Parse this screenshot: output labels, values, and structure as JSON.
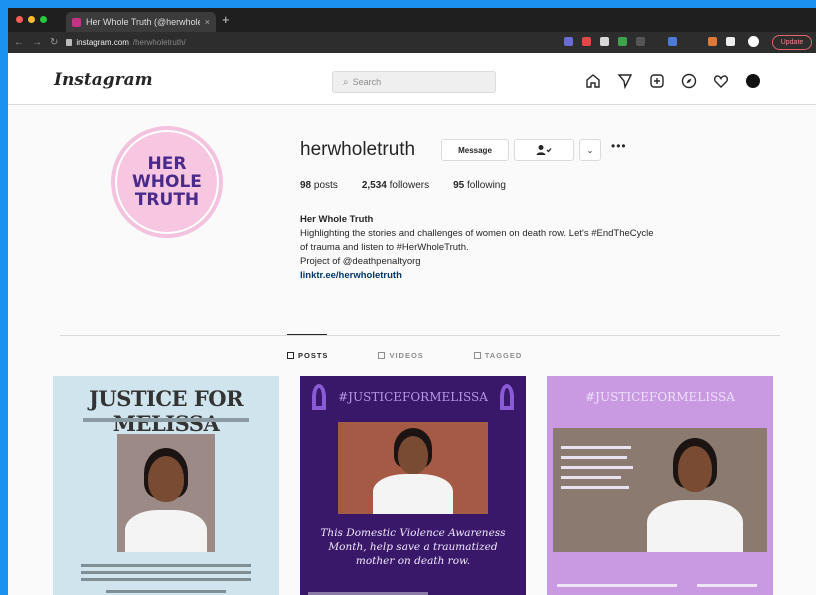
{
  "browser": {
    "tab_title": "Her Whole Truth (@herwhole...",
    "tab_close": "×",
    "new_tab": "+",
    "url_domain": "instagram.com",
    "url_path": "/herwholetruth/",
    "update_button": "Update"
  },
  "header": {
    "logo": "Instagram",
    "search_placeholder": "Search"
  },
  "profile": {
    "avatar_text_1": "HER",
    "avatar_text_2": "WHOLE",
    "avatar_text_3": "TRUTH",
    "username": "herwholetruth",
    "message_button": "Message",
    "dropdown": "⌄",
    "more": "•••",
    "posts_count": "98",
    "posts_label": "posts",
    "followers_count": "2,534",
    "followers_label": "followers",
    "following_count": "95",
    "following_label": "following",
    "display_name": "Her Whole Truth",
    "bio_line_1": "Highlighting the stories and challenges of women on death row. Let's #EndTheCycle",
    "bio_line_2": "of trauma and listen to #HerWholeTruth.",
    "bio_line_3": "Project of @deathpenaltyorg",
    "bio_link": "linktr.ee/herwholetruth"
  },
  "tabs": [
    {
      "label": "POSTS"
    },
    {
      "label": "VIDEOS"
    },
    {
      "label": "TAGGED"
    }
  ],
  "posts": [
    {
      "headline": "JUSTICE FOR MELISSA"
    },
    {
      "headline": "#JUSTICEFORMELISSA",
      "caption": "This Domestic Violence Awareness Month, help save a traumatized mother on death row."
    },
    {
      "headline": "#JUSTICEFORMELISSA"
    }
  ]
}
